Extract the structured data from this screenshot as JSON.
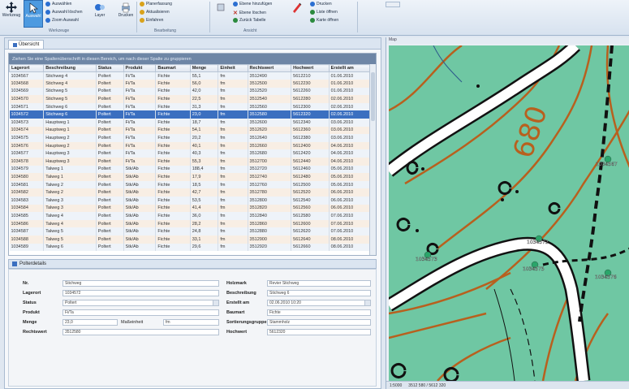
{
  "ribbon": {
    "buttons": [
      {
        "label": "Werkzeug",
        "icon": "move-icon"
      },
      {
        "label": "Auswahl",
        "icon": "cursor-icon"
      },
      {
        "label": "Layer",
        "icon": "layers-icon"
      },
      {
        "label": "Drucken",
        "icon": "print-icon"
      }
    ],
    "small_left": [
      {
        "label": "Auswählen",
        "color": "#2b6fd1"
      },
      {
        "label": "Auswahl löschen",
        "color": "#2b6fd1"
      },
      {
        "label": "Zoom Auswahl",
        "color": "#2b6fd1"
      }
    ],
    "small_mid": [
      {
        "label": "Planerfassung",
        "color": "#d9a21b"
      },
      {
        "label": "Aktualisieren",
        "color": "#d9a21b"
      },
      {
        "label": "Einfahren",
        "color": "#d9a21b"
      }
    ],
    "small_right": [
      {
        "label": "Ebene hinzufügen",
        "color": "#c0392b"
      },
      {
        "label": "Ebene löschen",
        "color": "#c0392b"
      },
      {
        "label": "Zurück Tabelle",
        "color": "#2b8a3e"
      }
    ],
    "small_far": [
      {
        "label": "Drucken",
        "color": "#2b6fd1"
      },
      {
        "label": "Liste öffnen",
        "color": "#2b8a3e"
      },
      {
        "label": "Karte öffnen",
        "color": "#2b8a3e"
      }
    ],
    "groups": [
      "Werkzeuge",
      "Bearbeitung",
      "Ansicht"
    ]
  },
  "left": {
    "tab_label": "Übersicht",
    "group_hint": "Ziehen Sie eine Spaltenüberschrift in diesen Bereich, um nach dieser Spalte zu gruppieren",
    "columns": [
      "Lagerort",
      "Beschreibung",
      "Status",
      "Produkt",
      "Baumart",
      "Menge",
      "Einheit",
      "Rechtswert",
      "Hochwert",
      "Erstellt am"
    ],
    "rows": [
      [
        "1034567",
        "Stichweg 4",
        "Poltert",
        "Fi/Ta",
        "Fichte",
        "55,1",
        "fm",
        "3512490",
        "5612210",
        "01.06.2010"
      ],
      [
        "1034568",
        "Stichweg 4",
        "Poltert",
        "Fi/Ta",
        "Fichte",
        "56,0",
        "fm",
        "3512500",
        "5612230",
        "01.06.2010"
      ],
      [
        "1034569",
        "Stichweg 5",
        "Poltert",
        "Fi/Ta",
        "Fichte",
        "42,0",
        "fm",
        "3512520",
        "5612260",
        "01.06.2010"
      ],
      [
        "1034570",
        "Stichweg 5",
        "Poltert",
        "Fi/Ta",
        "Fichte",
        "22,5",
        "fm",
        "3512540",
        "5612280",
        "02.06.2010"
      ],
      [
        "1034571",
        "Stichweg 6",
        "Poltert",
        "Fi/Ta",
        "Fichte",
        "31,3",
        "fm",
        "3512560",
        "5612300",
        "02.06.2010"
      ],
      [
        "1034572",
        "Stichweg 6",
        "Poltert",
        "Fi/Ta",
        "Fichte",
        "23,0",
        "fm",
        "3512580",
        "5612320",
        "02.06.2010"
      ],
      [
        "1034573",
        "Hauptweg 1",
        "Poltert",
        "Fi/Ta",
        "Fichte",
        "18,7",
        "fm",
        "3512600",
        "5612340",
        "03.06.2010"
      ],
      [
        "1034574",
        "Hauptweg 1",
        "Poltert",
        "Fi/Ta",
        "Fichte",
        "54,1",
        "fm",
        "3512620",
        "5612360",
        "03.06.2010"
      ],
      [
        "1034575",
        "Hauptweg 2",
        "Poltert",
        "Fi/Ta",
        "Fichte",
        "20,2",
        "fm",
        "3512640",
        "5612380",
        "03.06.2010"
      ],
      [
        "1034576",
        "Hauptweg 2",
        "Poltert",
        "Fi/Ta",
        "Fichte",
        "40,1",
        "fm",
        "3512660",
        "5612400",
        "04.06.2010"
      ],
      [
        "1034577",
        "Hauptweg 3",
        "Poltert",
        "Fi/Ta",
        "Fichte",
        "40,3",
        "fm",
        "3512680",
        "5612420",
        "04.06.2010"
      ],
      [
        "1034578",
        "Hauptweg 3",
        "Poltert",
        "Fi/Ta",
        "Fichte",
        "55,3",
        "fm",
        "3512700",
        "5612440",
        "04.06.2010"
      ],
      [
        "1034579",
        "Talweg 1",
        "Poltert",
        "Stk/Ab",
        "Fichte",
        "188,4",
        "fm",
        "3512720",
        "5612460",
        "05.06.2010"
      ],
      [
        "1034580",
        "Talweg 1",
        "Poltert",
        "Stk/Ab",
        "Fichte",
        "17,9",
        "fm",
        "3512740",
        "5612480",
        "05.06.2010"
      ],
      [
        "1034581",
        "Talweg 2",
        "Poltert",
        "Stk/Ab",
        "Fichte",
        "18,5",
        "fm",
        "3512760",
        "5612500",
        "05.06.2010"
      ],
      [
        "1034582",
        "Talweg 2",
        "Poltert",
        "Stk/Ab",
        "Fichte",
        "42,7",
        "fm",
        "3512780",
        "5612520",
        "06.06.2010"
      ],
      [
        "1034583",
        "Talweg 3",
        "Poltert",
        "Stk/Ab",
        "Fichte",
        "53,5",
        "fm",
        "3512800",
        "5612540",
        "06.06.2010"
      ],
      [
        "1034584",
        "Talweg 3",
        "Poltert",
        "Stk/Ab",
        "Fichte",
        "41,4",
        "fm",
        "3512820",
        "5612560",
        "06.06.2010"
      ],
      [
        "1034585",
        "Talweg 4",
        "Poltert",
        "Stk/Ab",
        "Fichte",
        "36,0",
        "fm",
        "3512840",
        "5612580",
        "07.06.2010"
      ],
      [
        "1034586",
        "Talweg 4",
        "Poltert",
        "Stk/Ab",
        "Fichte",
        "28,2",
        "fm",
        "3512860",
        "5612600",
        "07.06.2010"
      ],
      [
        "1034587",
        "Talweg 5",
        "Poltert",
        "Stk/Ab",
        "Fichte",
        "24,8",
        "fm",
        "3512880",
        "5612620",
        "07.06.2010"
      ],
      [
        "1034588",
        "Talweg 5",
        "Poltert",
        "Stk/Ab",
        "Fichte",
        "33,1",
        "fm",
        "3512900",
        "5612640",
        "08.06.2010"
      ],
      [
        "1034589",
        "Talweg 6",
        "Poltert",
        "Stk/Ab",
        "Fichte",
        "29,6",
        "fm",
        "3512920",
        "5612660",
        "08.06.2010"
      ]
    ],
    "selected_row": 5,
    "detail_title": "Polterdetails",
    "detail": {
      "nr_label": "Nr.",
      "nr_value": "Stichweg",
      "lagerort_label": "Lagerort",
      "lagerort_value": "1034572",
      "status_label": "Status",
      "status_value": "Poltert",
      "produkt_label": "Produkt",
      "produkt_value": "Fi/Ta",
      "menge_label": "Menge",
      "menge_value": "23,0",
      "einheit_label": "Maßeinheit",
      "einheit_value": "fm",
      "rechts_label": "Rechtswert",
      "rechts_value": "3512580",
      "revier_label": "Holzmark",
      "revier_value": "Revier Stichweg",
      "beschr_label": "Beschreibung",
      "beschr_value": "Stichweg 6",
      "erst_label": "Erstellt am",
      "erst_value": "02.06.2010 10:20",
      "baumart_label": "Baumart",
      "baumart_value": "Fichte",
      "sorte_label": "Sortierungsgruppe",
      "sorte_value": "Stammholz",
      "hoch_label": "Hochwert",
      "hoch_value": "5612320"
    }
  },
  "map": {
    "title": "Map",
    "contour_label": "680",
    "markers": [
      "1034567",
      "1034572",
      "1034573",
      "1034575",
      "1034576"
    ],
    "status": [
      "1:5000",
      "3512 580 / 5612 320"
    ]
  }
}
